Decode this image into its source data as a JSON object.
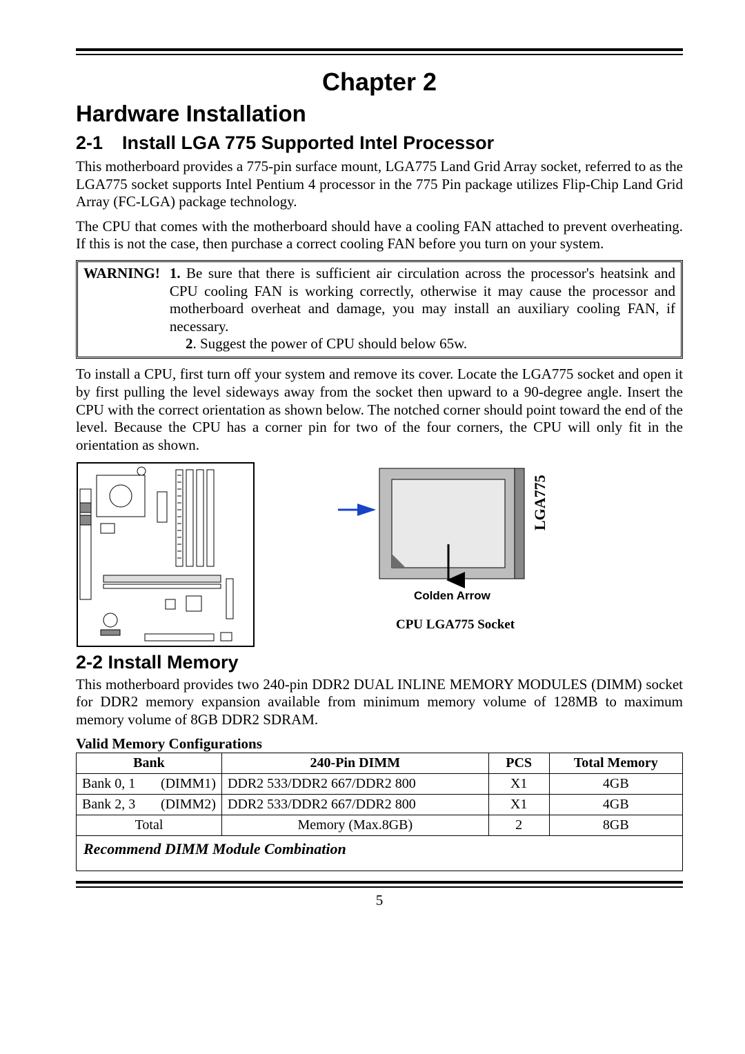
{
  "chapter": "Chapter 2",
  "h1": "Hardware Installation",
  "sec21": {
    "num": "2-1",
    "title": "Install LGA 775 Supported Intel Processor"
  },
  "p1": "This motherboard provides a 775-pin surface mount, LGA775 Land Grid Array socket, referred to as the LGA775 socket supports Intel Pentium 4 processor in the 775 Pin package utilizes Flip-Chip Land Grid Array (FC-LGA) package technology.",
  "p2": "The CPU that comes with the motherboard should have a cooling FAN attached to prevent overheating. If this is not the case, then purchase a correct cooling FAN before you turn on your system.",
  "warning": {
    "label": "WARNING!",
    "item1_prefix": "1.",
    "item1": " Be sure that there is sufficient air circulation across the processor's heatsink and CPU cooling FAN is working correctly, otherwise it may cause the processor and motherboard overheat and damage, you may install an auxiliary cooling FAN, if necessary.",
    "item2_prefix": "2",
    "item2": ". Suggest the power of CPU should below 65w."
  },
  "p3": "To install a CPU, first turn off your system and remove its cover. Locate the LGA775 socket and open it by first pulling the level sideways away from the socket then upward to a 90-degree angle. Insert the CPU with the correct orientation as shown below. The notched corner should point toward the end of the level. Because the CPU has a corner pin for two of the four corners, the CPU will only fit in the orientation as shown.",
  "figure": {
    "lga_label": "LGA775",
    "arrow_label": "Colden Arrow",
    "caption": "CPU LGA775 Socket"
  },
  "sec22": {
    "title": "2-2 Install Memory"
  },
  "p4": "This motherboard provides two 240-pin DDR2 DUAL INLINE MEMORY MODULES (DIMM) socket for DDR2 memory expansion available from minimum memory volume of 128MB to maximum memory volume of 8GB DDR2 SDRAM.",
  "valid_caption": "Valid Memory Configurations",
  "table": {
    "headers": {
      "bank": "Bank",
      "dimm": "240-Pin DIMM",
      "pcs": "PCS",
      "total": "Total Memory"
    },
    "rows": [
      {
        "bank_left": "Bank 0, 1",
        "bank_right": "(DIMM1)",
        "dimm": "DDR2 533/DDR2 667/DDR2 800",
        "pcs": "X1",
        "total": "4GB"
      },
      {
        "bank_left": "Bank 2, 3",
        "bank_right": "(DIMM2)",
        "dimm": "DDR2 533/DDR2 667/DDR2 800",
        "pcs": "X1",
        "total": "4GB"
      },
      {
        "bank_left": "Total",
        "bank_right": "",
        "dimm": "Memory (Max.8GB)",
        "pcs": "2",
        "total": "8GB"
      }
    ]
  },
  "recommend": "Recommend DIMM Module Combination",
  "pageno": "5"
}
